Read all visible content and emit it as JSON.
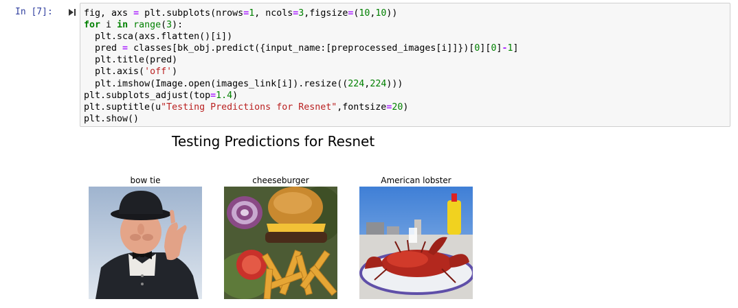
{
  "cell": {
    "prompt": "In [7]:",
    "code_lines": [
      [
        {
          "t": "fig, axs "
        },
        {
          "t": "=",
          "c": "op"
        },
        {
          "t": " plt.subplots(nrows"
        },
        {
          "t": "=",
          "c": "op"
        },
        {
          "t": "1",
          "c": "num"
        },
        {
          "t": ", ncols"
        },
        {
          "t": "=",
          "c": "op"
        },
        {
          "t": "3",
          "c": "num"
        },
        {
          "t": ",figsize"
        },
        {
          "t": "=",
          "c": "op"
        },
        {
          "t": "("
        },
        {
          "t": "10",
          "c": "num"
        },
        {
          "t": ","
        },
        {
          "t": "10",
          "c": "num"
        },
        {
          "t": "))"
        }
      ],
      [
        {
          "t": "for",
          "c": "kw"
        },
        {
          "t": " i "
        },
        {
          "t": "in",
          "c": "kw"
        },
        {
          "t": " "
        },
        {
          "t": "range",
          "c": "bi"
        },
        {
          "t": "("
        },
        {
          "t": "3",
          "c": "num"
        },
        {
          "t": "):"
        }
      ],
      [
        {
          "t": "  plt"
        },
        {
          "t": ".sca(axs.flatten()[i])"
        }
      ],
      [
        {
          "t": "  pred "
        },
        {
          "t": "=",
          "c": "op"
        },
        {
          "t": " classes[bk_obj.predict({input_name:[preprocessed_images[i]]})["
        },
        {
          "t": "0",
          "c": "num"
        },
        {
          "t": "]["
        },
        {
          "t": "0",
          "c": "num"
        },
        {
          "t": "]"
        },
        {
          "t": "-",
          "c": "op"
        },
        {
          "t": "1",
          "c": "num"
        },
        {
          "t": "]"
        }
      ],
      [
        {
          "t": "  plt"
        },
        {
          "t": ".title(pred)"
        }
      ],
      [
        {
          "t": "  plt"
        },
        {
          "t": ".axis("
        },
        {
          "t": "'off'",
          "c": "str"
        },
        {
          "t": ")"
        }
      ],
      [
        {
          "t": "  plt"
        },
        {
          "t": ".imshow(Image.open(images_link[i]).resize(("
        },
        {
          "t": "224",
          "c": "num"
        },
        {
          "t": ","
        },
        {
          "t": "224",
          "c": "num"
        },
        {
          "t": ")))"
        }
      ],
      [
        {
          "t": "plt.subplots_adjust(top"
        },
        {
          "t": "=",
          "c": "op"
        },
        {
          "t": "1.4",
          "c": "num"
        },
        {
          "t": ")"
        }
      ],
      [
        {
          "t": "plt.suptitle(u"
        },
        {
          "t": "\"Testing Predictions for Resnet\"",
          "c": "str"
        },
        {
          "t": ",fontsize"
        },
        {
          "t": "=",
          "c": "op"
        },
        {
          "t": "20",
          "c": "num"
        },
        {
          "t": ")"
        }
      ],
      [
        {
          "t": "plt.show()"
        }
      ]
    ]
  },
  "output": {
    "suptitle": "Testing Predictions for Resnet",
    "subplots": [
      {
        "title": "bow tie",
        "image": "man-in-bowler-hat-with-bow-tie"
      },
      {
        "title": "cheeseburger",
        "image": "cheeseburger-with-fries-and-onion"
      },
      {
        "title": "American lobster",
        "image": "red-lobster-on-plate"
      }
    ]
  },
  "icons": {
    "run": "step-forward-icon"
  },
  "colors": {
    "prompt": "#303f9f",
    "cell_bg": "#f7f7f7",
    "cell_border": "#cfcfcf",
    "keyword": "#008000",
    "operator": "#aa22ff",
    "string": "#ba2121"
  }
}
